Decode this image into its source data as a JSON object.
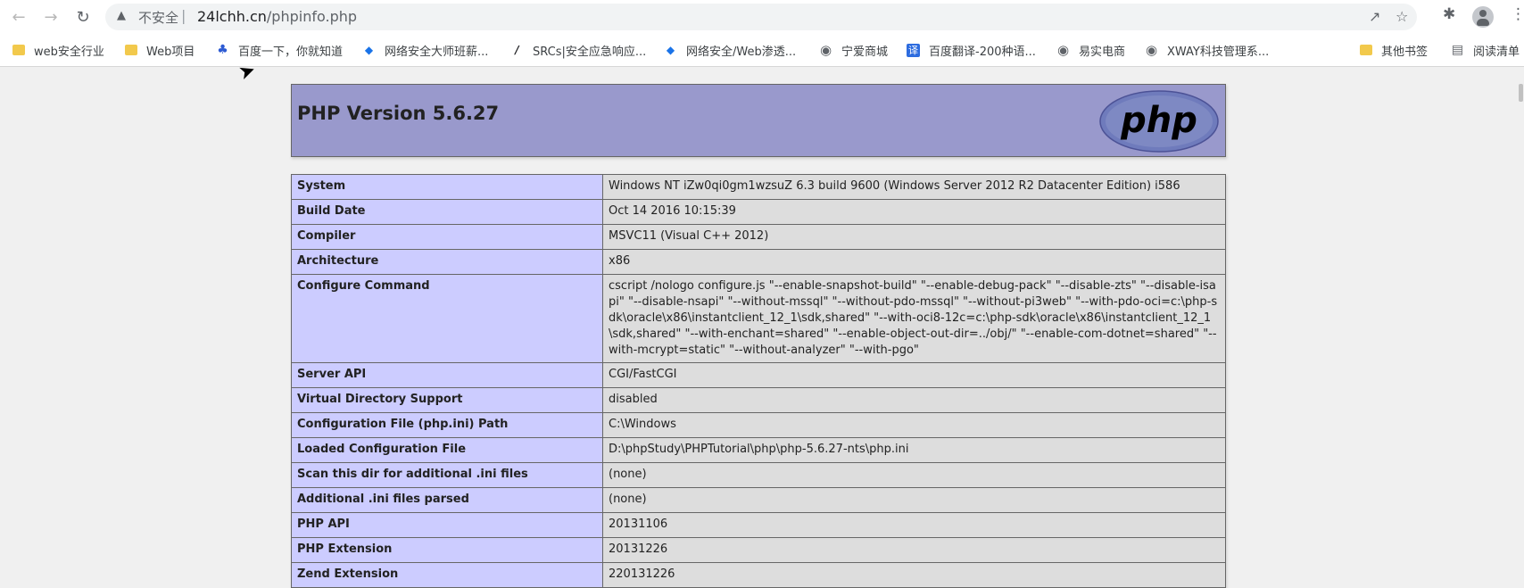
{
  "browser": {
    "security_label": "不安全",
    "url_host": "24lchh.cn",
    "url_path": "/phpinfo.php"
  },
  "bookmarks": [
    {
      "label": "web安全行业",
      "icon": "folder-icon"
    },
    {
      "label": "Web项目",
      "icon": "folder-icon"
    },
    {
      "label": "百度一下，你就知道",
      "icon": "baidu-icon"
    },
    {
      "label": "网络安全大师班薪...",
      "icon": "shield-icon"
    },
    {
      "label": "SRCs|安全应急响应...",
      "icon": "srcs-icon"
    },
    {
      "label": "网络安全/Web渗透...",
      "icon": "shield-icon"
    },
    {
      "label": "宁爱商城",
      "icon": "globe-icon"
    },
    {
      "label": "百度翻译-200种语...",
      "icon": "translate-icon"
    },
    {
      "label": "易实电商",
      "icon": "globe-icon"
    },
    {
      "label": "XWAY科技管理系...",
      "icon": "globe-icon"
    },
    {
      "label": "其他书签",
      "icon": "folder-icon"
    },
    {
      "label": "阅读清单",
      "icon": "reading-list-icon"
    }
  ],
  "phpinfo": {
    "title": "PHP Version 5.6.27",
    "logo_text": "php",
    "rows": [
      {
        "key": "System",
        "value": "Windows NT iZw0qi0gm1wzsuZ 6.3 build 9600 (Windows Server 2012 R2 Datacenter Edition) i586"
      },
      {
        "key": "Build Date",
        "value": "Oct 14 2016 10:15:39"
      },
      {
        "key": "Compiler",
        "value": "MSVC11 (Visual C++ 2012)"
      },
      {
        "key": "Architecture",
        "value": "x86"
      },
      {
        "key": "Configure Command",
        "value": "cscript /nologo configure.js \"--enable-snapshot-build\" \"--enable-debug-pack\" \"--disable-zts\" \"--disable-isapi\" \"--disable-nsapi\" \"--without-mssql\" \"--without-pdo-mssql\" \"--without-pi3web\" \"--with-pdo-oci=c:\\php-sdk\\oracle\\x86\\instantclient_12_1\\sdk,shared\" \"--with-oci8-12c=c:\\php-sdk\\oracle\\x86\\instantclient_12_1\\sdk,shared\" \"--with-enchant=shared\" \"--enable-object-out-dir=../obj/\" \"--enable-com-dotnet=shared\" \"--with-mcrypt=static\" \"--without-analyzer\" \"--with-pgo\""
      },
      {
        "key": "Server API",
        "value": "CGI/FastCGI"
      },
      {
        "key": "Virtual Directory Support",
        "value": "disabled"
      },
      {
        "key": "Configuration File (php.ini) Path",
        "value": "C:\\Windows"
      },
      {
        "key": "Loaded Configuration File",
        "value": "D:\\phpStudy\\PHPTutorial\\php\\php-5.6.27-nts\\php.ini"
      },
      {
        "key": "Scan this dir for additional .ini files",
        "value": "(none)"
      },
      {
        "key": "Additional .ini files parsed",
        "value": "(none)"
      },
      {
        "key": "PHP API",
        "value": "20131106"
      },
      {
        "key": "PHP Extension",
        "value": "20131226"
      },
      {
        "key": "Zend Extension",
        "value": "220131226"
      }
    ]
  }
}
